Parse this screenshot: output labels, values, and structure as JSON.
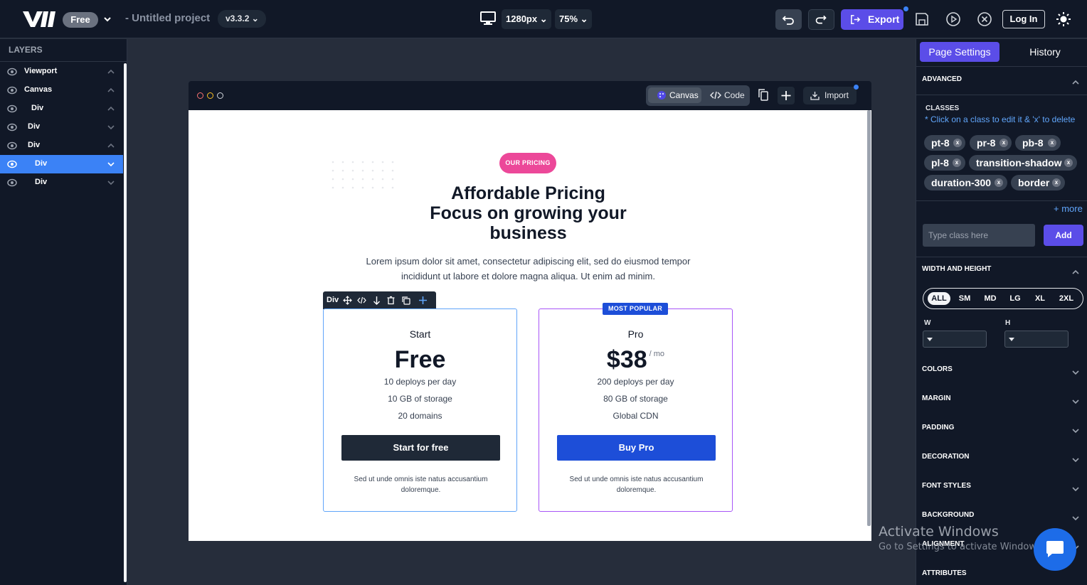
{
  "header": {
    "logo": "vii-logo",
    "plan": "Free",
    "project_name": "- Untitled project",
    "version": "v3.3.2",
    "resolution": "1280px",
    "zoom": "75%",
    "export_label": "Export",
    "login_label": "Log In"
  },
  "layers": {
    "title": "LAYERS",
    "items": [
      {
        "label": "Viewport",
        "expanded": true
      },
      {
        "label": "Canvas",
        "expanded": true
      },
      {
        "label": "Div",
        "expanded": true
      },
      {
        "label": "Div",
        "expanded": false
      },
      {
        "label": "Div",
        "expanded": true
      },
      {
        "label": "Div",
        "expanded": false,
        "selected": true
      },
      {
        "label": "Div",
        "expanded": false
      }
    ]
  },
  "frame": {
    "canvas_label": "Canvas",
    "code_label": "Code",
    "import_label": "Import"
  },
  "page": {
    "badge": "OUR PRICING",
    "headline_1": "Affordable Pricing",
    "headline_2": "Focus on growing your business",
    "lead": "Lorem ipsum dolor sit amet, consectetur adipiscing elit, sed do eiusmod tempor incididunt ut labore et dolore magna aliqua. Ut enim ad minim.",
    "toolbar_label": "Div",
    "popular_badge": "MOST POPULAR",
    "plans": [
      {
        "name": "Start",
        "price": "Free",
        "period": "",
        "features": [
          "10 deploys per day",
          "10 GB of storage",
          "20 domains"
        ],
        "cta": "Start for free",
        "note": "Sed ut unde omnis iste natus accusantium doloremque."
      },
      {
        "name": "Pro",
        "price": "$38",
        "period": "/ mo",
        "features": [
          "200 deploys per day",
          "80 GB of storage",
          "Global CDN"
        ],
        "cta": "Buy Pro",
        "note": "Sed ut unde omnis iste natus accusantium doloremque."
      }
    ]
  },
  "settings": {
    "tab_page": "Page Settings",
    "tab_history": "History",
    "advanced": "ADVANCED",
    "classes_title": "CLASSES",
    "classes_hint": "* Click on a class to edit it & 'x' to delete",
    "classes": [
      "pt-8",
      "pr-8",
      "pb-8",
      "pl-8",
      "transition-shadow",
      "duration-300",
      "border"
    ],
    "more": "+ more",
    "input_placeholder": "Type class here",
    "add_label": "Add",
    "width_height": "WIDTH AND HEIGHT",
    "breakpoints": [
      "ALL",
      "SM",
      "MD",
      "LG",
      "XL",
      "2XL"
    ],
    "active_breakpoint": "ALL",
    "w_label": "W",
    "h_label": "H",
    "sections": [
      "COLORS",
      "MARGIN",
      "PADDING",
      "DECORATION",
      "FONT STYLES",
      "BACKGROUND",
      "ALIGNMENT",
      "ATTRIBUTES"
    ]
  },
  "watermark": {
    "title": "Activate Windows",
    "subtitle": "Go to Settings to activate Windows."
  },
  "colors": {
    "accent": "#5b4de8",
    "selection": "#3b82f6",
    "pricing_badge": "#ec4899",
    "pro_button": "#1d4ed8"
  }
}
